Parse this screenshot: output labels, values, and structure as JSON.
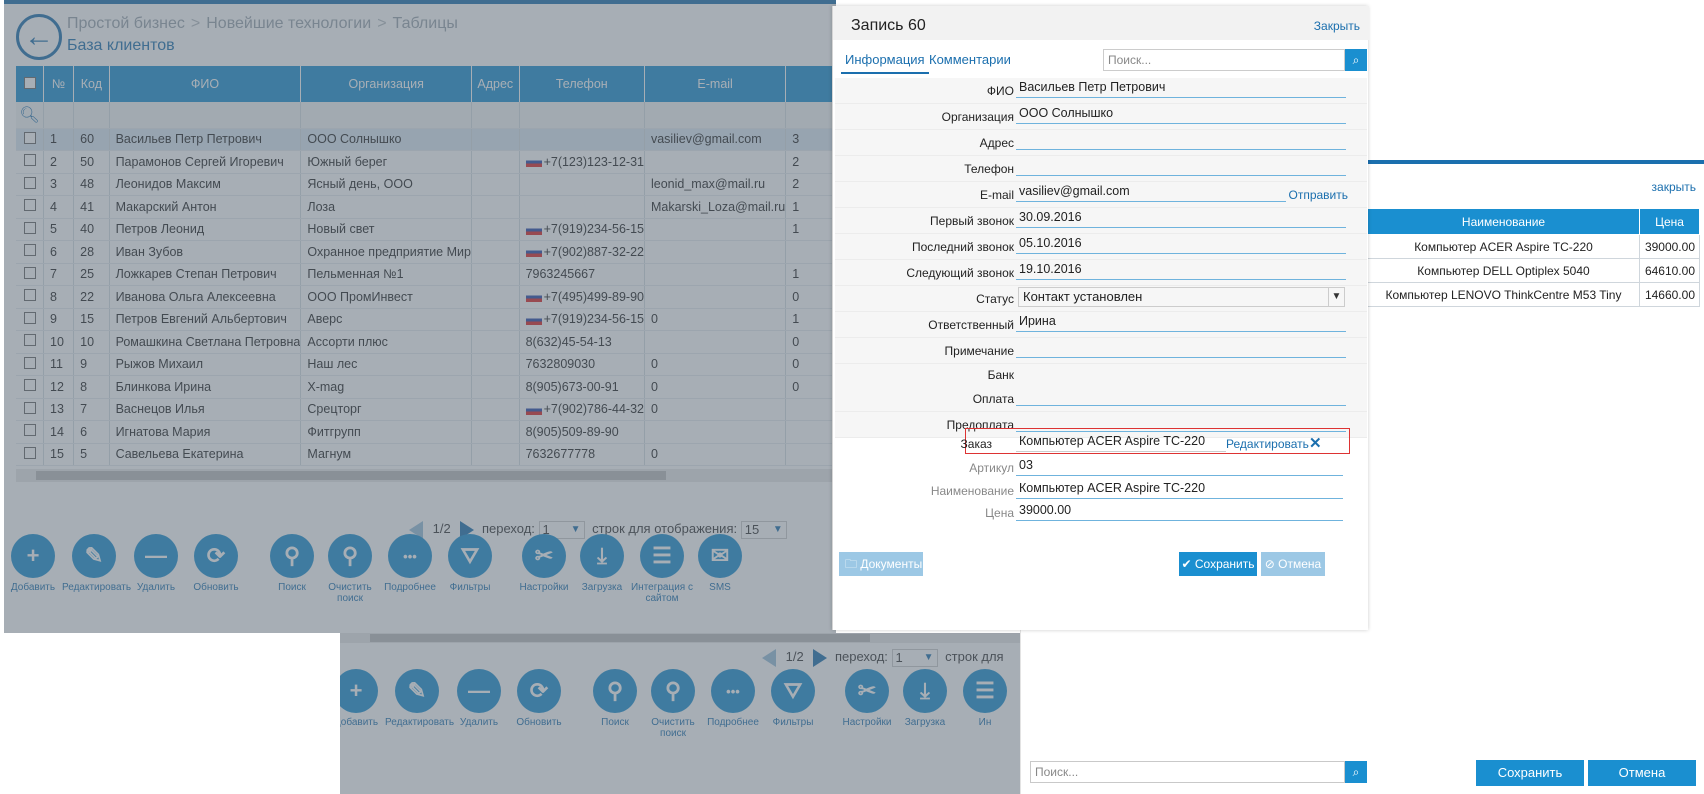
{
  "app": {
    "breadcrumbs": [
      "Простой бизнес",
      "Новейшие технологии",
      "Таблицы"
    ],
    "title": "База клиентов",
    "columns": [
      "№",
      "Код",
      "ФИО",
      "Организация",
      "Адрес",
      "Телефон",
      "E-mail"
    ],
    "rows": [
      {
        "n": "1",
        "code": "60",
        "fio": "Васильев Петр Петрович",
        "org": "ООО Солнышко",
        "addr": "",
        "phone": "",
        "flag": false,
        "email": "vasiliev@gmail.com",
        "extra": "3"
      },
      {
        "n": "2",
        "code": "50",
        "fio": "Парамонов Сергей Игоревич",
        "org": "Южный берег",
        "addr": "",
        "phone": "+7(123)123-12-31",
        "flag": true,
        "email": "",
        "extra": "2"
      },
      {
        "n": "3",
        "code": "48",
        "fio": "Леонидов Максим",
        "org": "Ясный день, ООО",
        "addr": "",
        "phone": "",
        "flag": false,
        "email": "leonid_max@mail.ru",
        "extra": "2"
      },
      {
        "n": "4",
        "code": "41",
        "fio": "Макарский Антон",
        "org": "Лоза",
        "addr": "",
        "phone": "",
        "flag": false,
        "email": "Makarski_Loza@mail.ru",
        "extra": "1"
      },
      {
        "n": "5",
        "code": "40",
        "fio": "Петров Леонид",
        "org": "Новый свет",
        "addr": "",
        "phone": "+7(919)234-56-15",
        "flag": true,
        "email": "",
        "extra": "1"
      },
      {
        "n": "6",
        "code": "28",
        "fio": "Иван Зубов",
        "org": "Охранное предприятие Мир",
        "addr": "",
        "phone": "+7(902)887-32-22",
        "flag": true,
        "email": "",
        "extra": ""
      },
      {
        "n": "7",
        "code": "25",
        "fio": "Ложкарев Степан Петрович",
        "org": "Пельменная №1",
        "addr": "",
        "phone": "7963245667",
        "flag": false,
        "email": "",
        "extra": "1"
      },
      {
        "n": "8",
        "code": "22",
        "fio": "Иванова Ольга Алексеевна",
        "org": "ООО ПромИнвест",
        "addr": "",
        "phone": "+7(495)499-89-90",
        "flag": true,
        "email": "",
        "extra": "0"
      },
      {
        "n": "9",
        "code": "15",
        "fio": "Петров Евгений Альбертович",
        "org": "Аверс",
        "addr": "",
        "phone": "+7(919)234-56-15",
        "flag": true,
        "email": "0",
        "extra": "1"
      },
      {
        "n": "10",
        "code": "10",
        "fio": "Ромашкина Светлана Петровна",
        "org": "Ассорти плюс",
        "addr": "",
        "phone": "8(632)45-54-13",
        "flag": false,
        "email": "",
        "extra": "0"
      },
      {
        "n": "11",
        "code": "9",
        "fio": "Рыжов Михаил",
        "org": "Наш лес",
        "addr": "",
        "phone": "7632809030",
        "flag": false,
        "email": "0",
        "extra": "0"
      },
      {
        "n": "12",
        "code": "8",
        "fio": "Блинкова Ирина",
        "org": "X-mag",
        "addr": "",
        "phone": "8(905)673-00-91",
        "flag": false,
        "email": "0",
        "extra": "0"
      },
      {
        "n": "13",
        "code": "7",
        "fio": "Васнецов Илья",
        "org": "Срецторг",
        "addr": "",
        "phone": "+7(902)786-44-32",
        "flag": true,
        "email": "0",
        "extra": ""
      },
      {
        "n": "14",
        "code": "6",
        "fio": "Игнатова Мария",
        "org": "Фитгрупп",
        "addr": "",
        "phone": "8(905)509-89-90",
        "flag": false,
        "email": "",
        "extra": ""
      },
      {
        "n": "15",
        "code": "5",
        "fio": "Савельева Екатерина",
        "org": "Магнум",
        "addr": "",
        "phone": "7632677778",
        "flag": false,
        "email": "0",
        "extra": ""
      }
    ],
    "pager": {
      "page": "1/2",
      "goto_label": "переход:",
      "goto_value": "1",
      "rows_label": "строк для отображения:",
      "rows_value": "15"
    },
    "toolbar": [
      "Добавить",
      "Редактировать",
      "Удалить",
      "Обновить",
      "Поиск",
      "Очистить поиск",
      "Подробнее",
      "Фильтры",
      "Настройки",
      "Загрузка",
      "Интеграция с сайтом",
      "SMS"
    ],
    "toolbar_icons": [
      "plus-icon",
      "pencil-icon",
      "minus-icon",
      "refresh-icon",
      "search-icon",
      "clear-search-icon",
      "more-icon",
      "filter-icon",
      "settings-icon",
      "download-icon",
      "integration-icon",
      "mail-icon"
    ],
    "scroll_left": "<"
  },
  "bgcopy": {
    "pager": {
      "page": "1/2",
      "goto_label": "переход:",
      "goto_value": "1",
      "rows_label": "строк для"
    },
    "toolbar": [
      "Добавить",
      "Редактировать",
      "Удалить",
      "Обновить",
      "Поиск",
      "Очистить поиск",
      "Подробнее",
      "Фильтры",
      "Настройки",
      "Загрузка",
      "Ин"
    ]
  },
  "side": {
    "close": "закрыть",
    "columns": [
      "Наименование",
      "Цена"
    ],
    "rows": [
      {
        "name": "Компьютер ACER Aspire TC-220",
        "price": "39000.00"
      },
      {
        "name": "Компьютер DELL Optiplex 5040",
        "price": "64610.00"
      },
      {
        "name": "Компьютер LENOVO ThinkCentre M53 Tiny",
        "price": "14660.00"
      }
    ],
    "search_placeholder": "Поиск...",
    "save": "Сохранить",
    "cancel": "Отмена"
  },
  "modal": {
    "title": "Запись 60",
    "close": "Закрыть",
    "tabs": [
      "Информация",
      "Комментарии"
    ],
    "search_placeholder": "Поиск...",
    "fields": {
      "fio": {
        "label": "ФИО",
        "value": "Васильев Петр Петрович"
      },
      "org": {
        "label": "Организация",
        "value": "ООО Солнышко"
      },
      "addr": {
        "label": "Адрес",
        "value": ""
      },
      "phone": {
        "label": "Телефон",
        "value": ""
      },
      "email": {
        "label": "E-mail",
        "value": "vasiliev@gmail.com",
        "action": "Отправить"
      },
      "first_call": {
        "label": "Первый звонок",
        "value": "30.09.2016"
      },
      "last_call": {
        "label": "Последний звонок",
        "value": "05.10.2016"
      },
      "next_call": {
        "label": "Следующий звонок",
        "value": "19.10.2016"
      },
      "status": {
        "label": "Статус",
        "value": "Контакт установлен"
      },
      "responsible": {
        "label": "Ответственный",
        "value": "Ирина"
      },
      "note": {
        "label": "Примечание",
        "value": ""
      },
      "bank": {
        "label": "Банк",
        "value": ""
      },
      "payment": {
        "label": "Оплата",
        "value": ""
      },
      "prepay": {
        "label": "Предоплата",
        "value": ""
      },
      "order": {
        "label": "Заказ",
        "value": "Компьютер ACER Aspire TC-220",
        "edit": "Редактировать"
      },
      "article": {
        "label": "Артикул",
        "value": "03"
      },
      "name": {
        "label": "Наименование",
        "value": "Компьютер ACER Aspire TC-220"
      },
      "price": {
        "label": "Цена",
        "value": "39000.00"
      }
    },
    "docs": "Документы",
    "save": "Сохранить",
    "cancel": "Отмена"
  },
  "colors": {
    "accent": "#1a8fd0",
    "dark_accent": "#1b6fae",
    "overlay": "#5f6c78",
    "order_border": "#dd3333"
  }
}
